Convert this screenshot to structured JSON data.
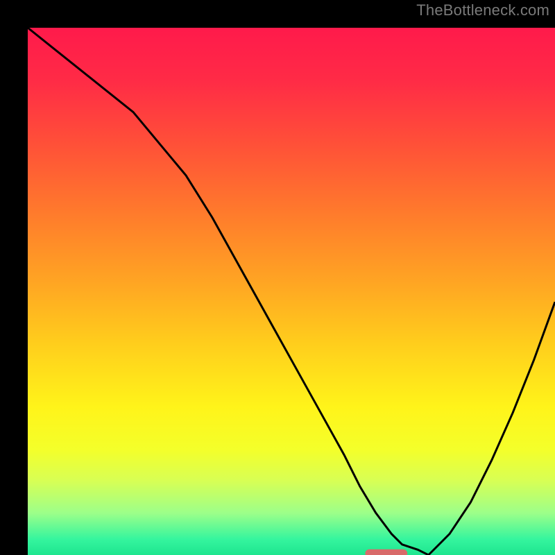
{
  "watermark": "TheBottleneck.com",
  "chart_data": {
    "type": "line",
    "title": "",
    "xlabel": "",
    "ylabel": "",
    "xlim": [
      0,
      100
    ],
    "ylim": [
      0,
      100
    ],
    "background_gradient": {
      "stops": [
        {
          "offset": 0.0,
          "color": "#ff1a4b"
        },
        {
          "offset": 0.1,
          "color": "#ff2b46"
        },
        {
          "offset": 0.22,
          "color": "#ff5038"
        },
        {
          "offset": 0.35,
          "color": "#ff7a2c"
        },
        {
          "offset": 0.48,
          "color": "#ffa423"
        },
        {
          "offset": 0.6,
          "color": "#ffce1c"
        },
        {
          "offset": 0.72,
          "color": "#fff41a"
        },
        {
          "offset": 0.8,
          "color": "#f4ff2a"
        },
        {
          "offset": 0.86,
          "color": "#d7ff55"
        },
        {
          "offset": 0.92,
          "color": "#9dff89"
        },
        {
          "offset": 0.97,
          "color": "#35f59e"
        },
        {
          "offset": 1.0,
          "color": "#1ee58f"
        }
      ]
    },
    "series": [
      {
        "name": "bottleneck-curve",
        "color": "#000000",
        "stroke_width": 3,
        "x": [
          0,
          5,
          10,
          15,
          20,
          25,
          30,
          35,
          40,
          45,
          50,
          55,
          60,
          63,
          66,
          69,
          71,
          74,
          76,
          80,
          84,
          88,
          92,
          96,
          100
        ],
        "y": [
          100,
          96,
          92,
          88,
          84,
          78,
          72,
          64,
          55,
          46,
          37,
          28,
          19,
          13,
          8,
          4,
          2,
          1,
          0,
          4,
          10,
          18,
          27,
          37,
          48
        ]
      }
    ],
    "marker": {
      "name": "optimal-range",
      "color": "#d86a6a",
      "x_start": 64,
      "x_end": 72,
      "y": 0.3,
      "thickness": 12,
      "radius": 6
    }
  }
}
